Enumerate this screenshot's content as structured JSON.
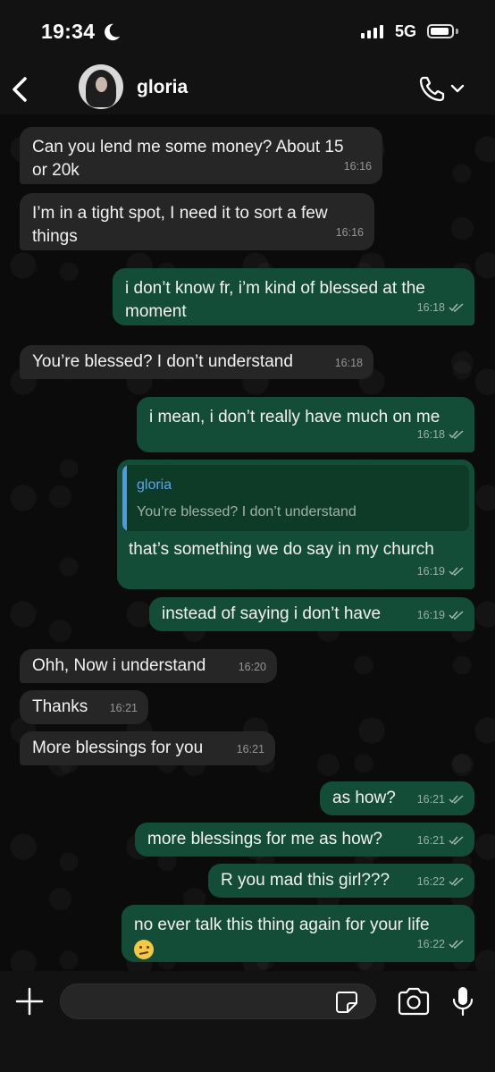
{
  "status_bar": {
    "time": "19:34",
    "network": "5G"
  },
  "header": {
    "contact_name": "gloria"
  },
  "messages": [
    {
      "text_line1": "Can you lend me some money? About 15",
      "text_line2": "or 20k",
      "time": "16:16"
    },
    {
      "text_line1": "I’m in a tight spot, I need it to sort a few",
      "text_line2": "things",
      "time": "16:16"
    },
    {
      "text_line1": "i don’t know fr, i’m kind of blessed at the",
      "text_line2": "moment",
      "time": "16:18"
    },
    {
      "text": "You’re blessed? I don’t understand",
      "time": "16:18"
    },
    {
      "text": "i mean, i don’t really have much on me",
      "time": "16:18"
    },
    {
      "quote_name": "gloria",
      "quote_text": "You’re blessed? I don’t understand",
      "text": "that’s something we do say in my church",
      "time": "16:19"
    },
    {
      "text": "instead of saying i don’t have",
      "time": "16:19"
    },
    {
      "text": "Ohh, Now i understand",
      "time": "16:20"
    },
    {
      "text": "Thanks",
      "time": "16:21"
    },
    {
      "text": "More blessings for you",
      "time": "16:21"
    },
    {
      "text": "as how?",
      "time": "16:21"
    },
    {
      "text": "more blessings for me as how?",
      "time": "16:21"
    },
    {
      "text": "R you mad this girl???",
      "time": "16:22"
    },
    {
      "text": "no ever talk this thing again for your life",
      "emoji": "confused-face",
      "time": "16:22"
    }
  ],
  "colors": {
    "incoming": "#262626",
    "outgoing": "#144d37",
    "quote_accent": "#4f9ae8"
  }
}
